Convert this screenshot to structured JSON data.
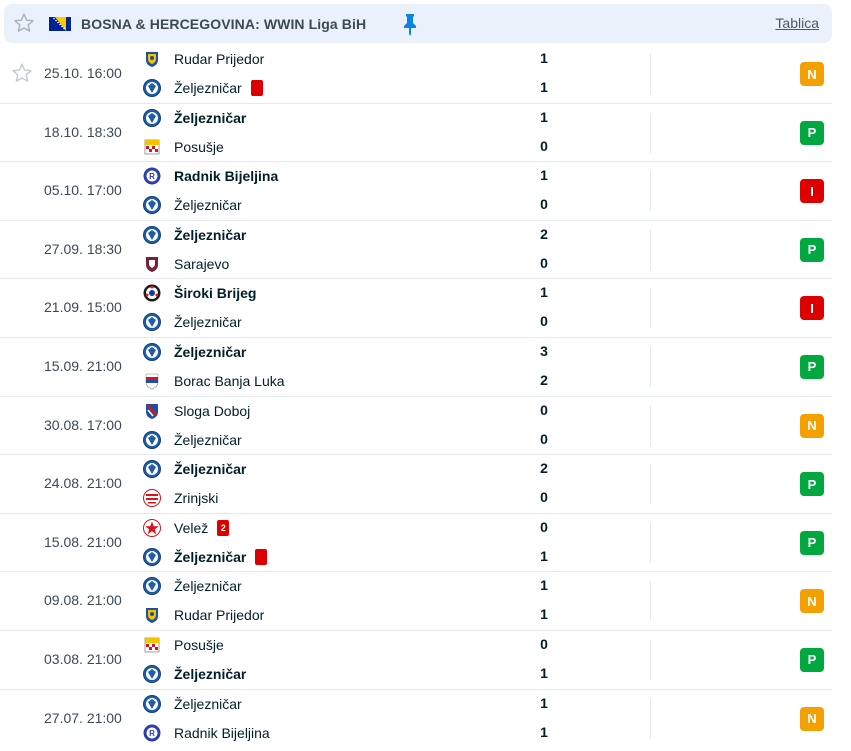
{
  "header": {
    "league": "BOSNA & HERCEGOVINA: WWIN Liga BiH",
    "table_link": "Tablica",
    "icons": {
      "star": "star-outline-icon",
      "flag": "bosnia-flag-icon",
      "pin": "pin-icon"
    }
  },
  "colors": {
    "win": "#00a83f",
    "draw": "#f3a000",
    "loss": "#dc0000",
    "header_bg": "#eaf1fb"
  },
  "matches": [
    {
      "time": "25.10. 16:00",
      "star": true,
      "home": {
        "name": "Rudar Prijedor",
        "score": "1",
        "bold": false,
        "logo": "rudar",
        "card": ""
      },
      "away": {
        "name": "Željezničar",
        "score": "1",
        "bold": false,
        "logo": "zeljo",
        "card": "red"
      },
      "result": "N"
    },
    {
      "time": "18.10. 18:30",
      "star": false,
      "home": {
        "name": "Željezničar",
        "score": "1",
        "bold": true,
        "logo": "zeljo",
        "card": ""
      },
      "away": {
        "name": "Posušje",
        "score": "0",
        "bold": false,
        "logo": "posusje",
        "card": ""
      },
      "result": "P"
    },
    {
      "time": "05.10. 17:00",
      "star": false,
      "home": {
        "name": "Radnik Bijeljina",
        "score": "1",
        "bold": true,
        "logo": "radnik",
        "card": ""
      },
      "away": {
        "name": "Željezničar",
        "score": "0",
        "bold": false,
        "logo": "zeljo",
        "card": ""
      },
      "result": "I"
    },
    {
      "time": "27.09. 18:30",
      "star": false,
      "home": {
        "name": "Željezničar",
        "score": "2",
        "bold": true,
        "logo": "zeljo",
        "card": ""
      },
      "away": {
        "name": "Sarajevo",
        "score": "0",
        "bold": false,
        "logo": "sarajevo",
        "card": ""
      },
      "result": "P"
    },
    {
      "time": "21.09. 15:00",
      "star": false,
      "home": {
        "name": "Široki Brijeg",
        "score": "1",
        "bold": true,
        "logo": "siroki",
        "card": ""
      },
      "away": {
        "name": "Željezničar",
        "score": "0",
        "bold": false,
        "logo": "zeljo",
        "card": ""
      },
      "result": "I"
    },
    {
      "time": "15.09. 21:00",
      "star": false,
      "home": {
        "name": "Željezničar",
        "score": "3",
        "bold": true,
        "logo": "zeljo",
        "card": ""
      },
      "away": {
        "name": "Borac Banja Luka",
        "score": "2",
        "bold": false,
        "logo": "borac",
        "card": ""
      },
      "result": "P"
    },
    {
      "time": "30.08. 17:00",
      "star": false,
      "home": {
        "name": "Sloga Doboj",
        "score": "0",
        "bold": false,
        "logo": "sloga",
        "card": ""
      },
      "away": {
        "name": "Željezničar",
        "score": "0",
        "bold": false,
        "logo": "zeljo",
        "card": ""
      },
      "result": "N"
    },
    {
      "time": "24.08. 21:00",
      "star": false,
      "home": {
        "name": "Željezničar",
        "score": "2",
        "bold": true,
        "logo": "zeljo",
        "card": ""
      },
      "away": {
        "name": "Zrinjski",
        "score": "0",
        "bold": false,
        "logo": "zrinjski",
        "card": ""
      },
      "result": "P"
    },
    {
      "time": "15.08. 21:00",
      "star": false,
      "home": {
        "name": "Velež",
        "score": "0",
        "bold": false,
        "logo": "velez",
        "card": "2"
      },
      "away": {
        "name": "Željezničar",
        "score": "1",
        "bold": true,
        "logo": "zeljo",
        "card": "red"
      },
      "result": "P"
    },
    {
      "time": "09.08. 21:00",
      "star": false,
      "home": {
        "name": "Željezničar",
        "score": "1",
        "bold": false,
        "logo": "zeljo",
        "card": ""
      },
      "away": {
        "name": "Rudar Prijedor",
        "score": "1",
        "bold": false,
        "logo": "rudar",
        "card": ""
      },
      "result": "N"
    },
    {
      "time": "03.08. 21:00",
      "star": false,
      "home": {
        "name": "Posušje",
        "score": "0",
        "bold": false,
        "logo": "posusje",
        "card": ""
      },
      "away": {
        "name": "Željezničar",
        "score": "1",
        "bold": true,
        "logo": "zeljo",
        "card": ""
      },
      "result": "P"
    },
    {
      "time": "27.07. 21:00",
      "star": false,
      "home": {
        "name": "Željezničar",
        "score": "1",
        "bold": false,
        "logo": "zeljo",
        "card": ""
      },
      "away": {
        "name": "Radnik Bijeljina",
        "score": "1",
        "bold": false,
        "logo": "radnik",
        "card": ""
      },
      "result": "N"
    }
  ]
}
